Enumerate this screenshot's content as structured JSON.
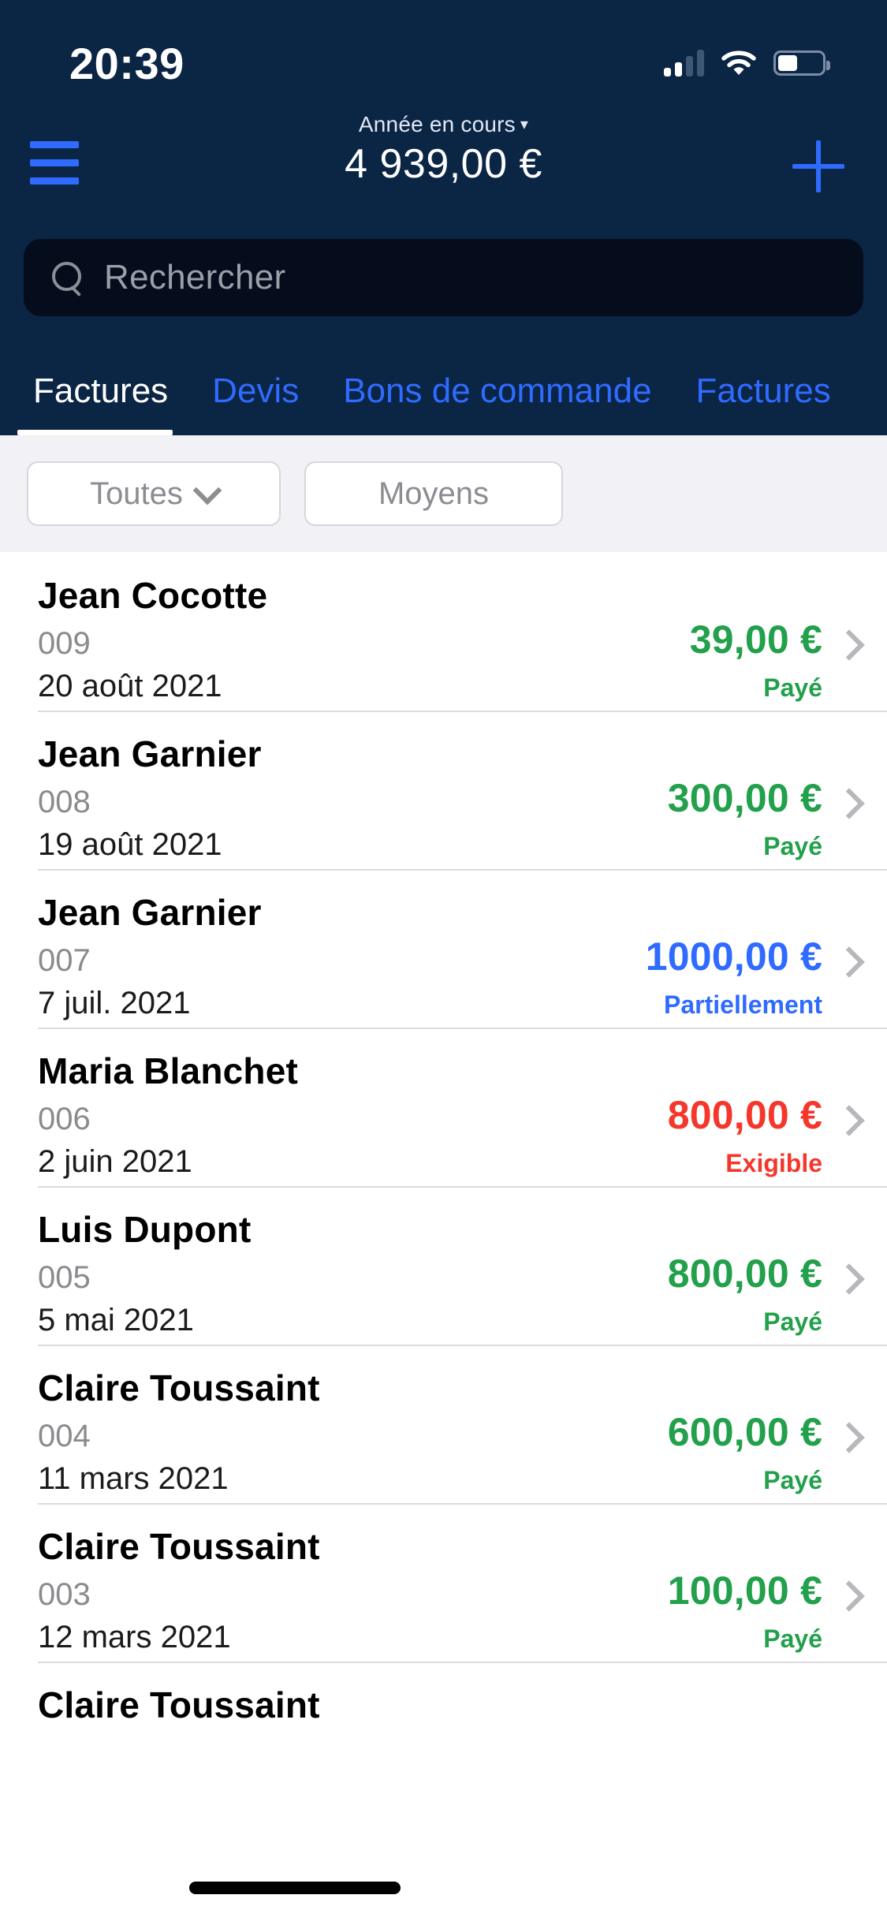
{
  "status_bar": {
    "time": "20:39",
    "cellular_icon": "cellular-signal-icon",
    "cellular_bars_filled": 2,
    "cellular_bars_total": 4,
    "wifi_icon": "wifi-icon",
    "battery_icon": "battery-icon",
    "battery_level_percent": 45
  },
  "nav": {
    "menu_icon": "hamburger-menu-icon",
    "period_label": "Année en cours",
    "period_caret": "▾",
    "total_amount": "4 939,00 €",
    "add_icon": "plus-icon"
  },
  "search": {
    "icon": "search-icon",
    "placeholder": "Rechercher",
    "value": ""
  },
  "tabs": {
    "active_index": 0,
    "items": [
      {
        "label": "Factures"
      },
      {
        "label": "Devis"
      },
      {
        "label": "Bons de commande"
      },
      {
        "label": "Factures"
      }
    ]
  },
  "filters": {
    "all": {
      "label": "Toutes",
      "caret_icon": "chevron-down-icon"
    },
    "means": {
      "label": "Moyens"
    }
  },
  "colors": {
    "header_navy": "#0B2545",
    "accent_blue": "#2F6BFF",
    "paid_green": "#22A04B",
    "partial_blue": "#2F6BFF",
    "due_red": "#F5362B",
    "filter_bg": "#F1F1F6",
    "search_bg": "#050C1C"
  },
  "invoices": [
    {
      "name": "Jean Cocotte",
      "number": "009",
      "date": "20 août 2021",
      "amount": "39,00 €",
      "status": "Payé",
      "status_color": "#22A04B",
      "chevron_icon": "chevron-right-icon"
    },
    {
      "name": "Jean Garnier",
      "number": "008",
      "date": "19 août 2021",
      "amount": "300,00 €",
      "status": "Payé",
      "status_color": "#22A04B",
      "chevron_icon": "chevron-right-icon"
    },
    {
      "name": "Jean Garnier",
      "number": "007",
      "date": "7 juil. 2021",
      "amount": "1000,00 €",
      "status": "Partiellement",
      "status_color": "#2F6BFF",
      "chevron_icon": "chevron-right-icon"
    },
    {
      "name": "Maria Blanchet",
      "number": "006",
      "date": "2 juin 2021",
      "amount": "800,00 €",
      "status": "Exigible",
      "status_color": "#F5362B",
      "chevron_icon": "chevron-right-icon"
    },
    {
      "name": "Luis Dupont",
      "number": "005",
      "date": "5 mai 2021",
      "amount": "800,00 €",
      "status": "Payé",
      "status_color": "#22A04B",
      "chevron_icon": "chevron-right-icon"
    },
    {
      "name": "Claire Toussaint",
      "number": "004",
      "date": "11 mars 2021",
      "amount": "600,00 €",
      "status": "Payé",
      "status_color": "#22A04B",
      "chevron_icon": "chevron-right-icon"
    },
    {
      "name": "Claire Toussaint",
      "number": "003",
      "date": "12 mars 2021",
      "amount": "100,00 €",
      "status": "Payé",
      "status_color": "#22A04B",
      "chevron_icon": "chevron-right-icon"
    },
    {
      "name": "Claire Toussaint",
      "number": "",
      "date": "",
      "amount": "",
      "status": "",
      "status_color": "#22A04B",
      "chevron_icon": "chevron-right-icon"
    }
  ],
  "home_indicator": "home-indicator"
}
